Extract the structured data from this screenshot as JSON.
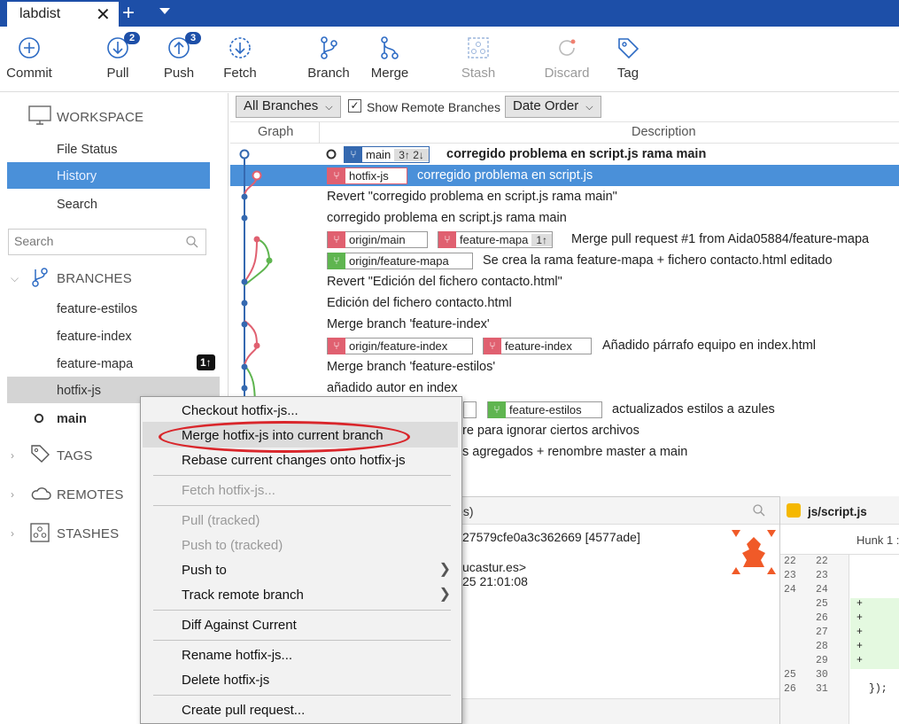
{
  "tab": {
    "title": "labdist",
    "close": "✕",
    "new": "+"
  },
  "toolbar": [
    {
      "label": "Commit",
      "badge": null,
      "disabled": false
    },
    {
      "label": "Pull",
      "badge": "2",
      "disabled": false
    },
    {
      "label": "Push",
      "badge": "3",
      "disabled": false
    },
    {
      "label": "Fetch",
      "badge": null,
      "disabled": false
    },
    {
      "label": "Branch",
      "badge": null,
      "disabled": false
    },
    {
      "label": "Merge",
      "badge": null,
      "disabled": false
    },
    {
      "label": "Stash",
      "badge": null,
      "disabled": true
    },
    {
      "label": "Discard",
      "badge": null,
      "disabled": true
    },
    {
      "label": "Tag",
      "badge": null,
      "disabled": false
    }
  ],
  "sidebar": {
    "workspace": "WORKSPACE",
    "file_status": "File Status",
    "history": "History",
    "search": "Search",
    "search_placeholder": "Search",
    "branches_head": "BRANCHES",
    "branches": [
      "feature-estilos",
      "feature-index",
      "feature-mapa",
      "hotfix-js",
      "main"
    ],
    "mapa_badge": "1↑",
    "tags": "TAGS",
    "remotes": "REMOTES",
    "stashes": "STASHES"
  },
  "filter": {
    "branches": "All Branches",
    "show_remote": "Show Remote Branches",
    "order": "Date Order"
  },
  "grid": {
    "col_graph": "Graph",
    "col_desc": "Description"
  },
  "commits": [
    {
      "labels": [
        {
          "text": "main",
          "color": "blue",
          "ahead": "3↑ 2↓"
        }
      ],
      "desc": "corregido problema en script.js rama main",
      "bold": true
    },
    {
      "labels": [
        {
          "text": "hotfix-js",
          "color": "red"
        }
      ],
      "desc": "corregido problema en script.js",
      "selected": true
    },
    {
      "labels": [],
      "desc": "Revert \"corregido problema en script.js rama main\""
    },
    {
      "labels": [],
      "desc": "corregido problema en script.js rama main"
    },
    {
      "labels": [
        {
          "text": "origin/main",
          "color": "red"
        },
        {
          "text": "feature-mapa",
          "color": "red",
          "ahead": "1↑"
        }
      ],
      "desc": "Merge pull request #1 from Aida05884/feature-mapa"
    },
    {
      "labels": [
        {
          "text": "origin/feature-mapa",
          "color": "green"
        }
      ],
      "desc": "Se crea la rama feature-mapa + fichero contacto.html editado"
    },
    {
      "labels": [],
      "desc": "Revert \"Edición del fichero contacto.html\""
    },
    {
      "labels": [],
      "desc": "Edición del fichero contacto.html"
    },
    {
      "labels": [],
      "desc": "Merge branch 'feature-index'"
    },
    {
      "labels": [
        {
          "text": "origin/feature-index",
          "color": "red"
        },
        {
          "text": "feature-index",
          "color": "red"
        }
      ],
      "desc": "Añadido párrafo equipo en index.html"
    },
    {
      "labels": [],
      "desc": "Merge branch 'feature-estilos'"
    },
    {
      "labels": [],
      "desc": "añadido autor en index"
    },
    {
      "labels": [
        {
          "text": "feature-estilos",
          "color": "green"
        }
      ],
      "desc": "actualizados estilos a azules"
    },
    {
      "labels": [],
      "desc": "re para ignorar ciertos archivos"
    },
    {
      "labels": [],
      "desc": "s agregados + renombre master a main"
    }
  ],
  "details": {
    "head": "les)",
    "hash": "27579cfe0a3c362669 [4577ade]",
    "author": "ucastur.es>",
    "date": "25 21:01:08"
  },
  "diff": {
    "file": "js/script.js",
    "hunk": "Hunk 1 :",
    "old_lines": [
      "22",
      "23",
      "24",
      "",
      "",
      "",
      "",
      "",
      "25",
      "26"
    ],
    "new_lines": [
      "22",
      "23",
      "24",
      "25",
      "26",
      "27",
      "28",
      "29",
      "30",
      "31"
    ],
    "code": [
      "",
      "",
      "",
      "+",
      "+",
      "+",
      "+",
      "+",
      "",
      "});"
    ]
  },
  "context_menu": {
    "checkout": "Checkout hotfix-js...",
    "merge": "Merge hotfix-js into current branch",
    "rebase": "Rebase current changes onto hotfix-js",
    "fetch": "Fetch hotfix-js...",
    "pull": "Pull  (tracked)",
    "push_tracked": "Push to  (tracked)",
    "push_to": "Push to",
    "track": "Track remote branch",
    "diff": "Diff Against Current",
    "rename": "Rename hotfix-js...",
    "delete": "Delete hotfix-js",
    "pr": "Create pull request..."
  },
  "colors": {
    "accent": "#1d4fa8",
    "selection": "#4a90d9",
    "red_branch": "#e06070",
    "green_branch": "#5fb550",
    "highlight_ring": "#d9262b"
  }
}
